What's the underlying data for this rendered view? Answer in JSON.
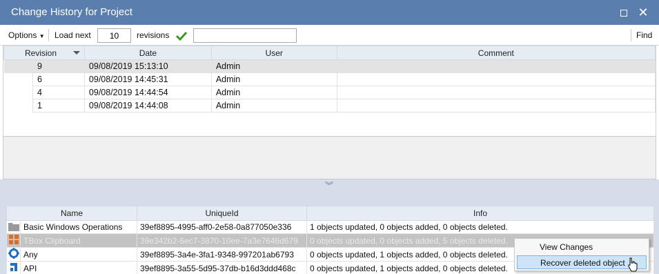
{
  "window": {
    "title": "Change History for Project",
    "maximize_label": "",
    "close_label": "✕"
  },
  "toolbar": {
    "options_label": "Options",
    "load_next_label": "Load next",
    "load_count": "10",
    "revisions_label": "revisions",
    "filter_value": "",
    "find_label": "Find"
  },
  "revisions_grid": {
    "headers": [
      "Revision",
      "Date",
      "User",
      "Comment"
    ],
    "rows": [
      {
        "revision": "9",
        "date": "09/08/2019 15:13:10",
        "user": "Admin",
        "comment": ""
      },
      {
        "revision": "6",
        "date": "09/08/2019 14:45:31",
        "user": "Admin",
        "comment": ""
      },
      {
        "revision": "4",
        "date": "09/08/2019 14:44:54",
        "user": "Admin",
        "comment": ""
      },
      {
        "revision": "1",
        "date": "09/08/2019 14:44:08",
        "user": "Admin",
        "comment": ""
      }
    ]
  },
  "objects_grid": {
    "headers": [
      "Name",
      "UniqueId",
      "Info"
    ],
    "rows": [
      {
        "icon": "folder-icon",
        "name": "Basic Windows Operations",
        "uid": "39ef8895-4995-aff0-2e58-0a877050e336",
        "info": "1 objects updated, 0 objects added, 0 objects deleted."
      },
      {
        "icon": "puzzle-icon",
        "name": "TBox Clipboard",
        "uid": "39e342b2-6ec7-3870-10ee-7a3e7646d679",
        "info": "0 objects updated, 0 objects added, 5 objects deleted."
      },
      {
        "icon": "gear-icon",
        "name": "Any",
        "uid": "39ef8895-3a4e-3fa1-9348-997201ab6793",
        "info": "0 objects updated, 1 objects added, 0 objects deleted."
      },
      {
        "icon": "api-icon",
        "name": "API",
        "uid": "39ef8895-3a55-5d95-37db-b16d3ddd468c",
        "info": "0 objects updated, 1 objects added, 0 objects deleted."
      }
    ]
  },
  "context_menu": {
    "items": [
      "View Changes",
      "Recover deleted object"
    ]
  },
  "colors": {
    "titlebar": "#5a7fae",
    "header_bg": "#e6ecf4",
    "pane_bg": "#d4dde9",
    "menu_highlight": "#cce4f7"
  }
}
